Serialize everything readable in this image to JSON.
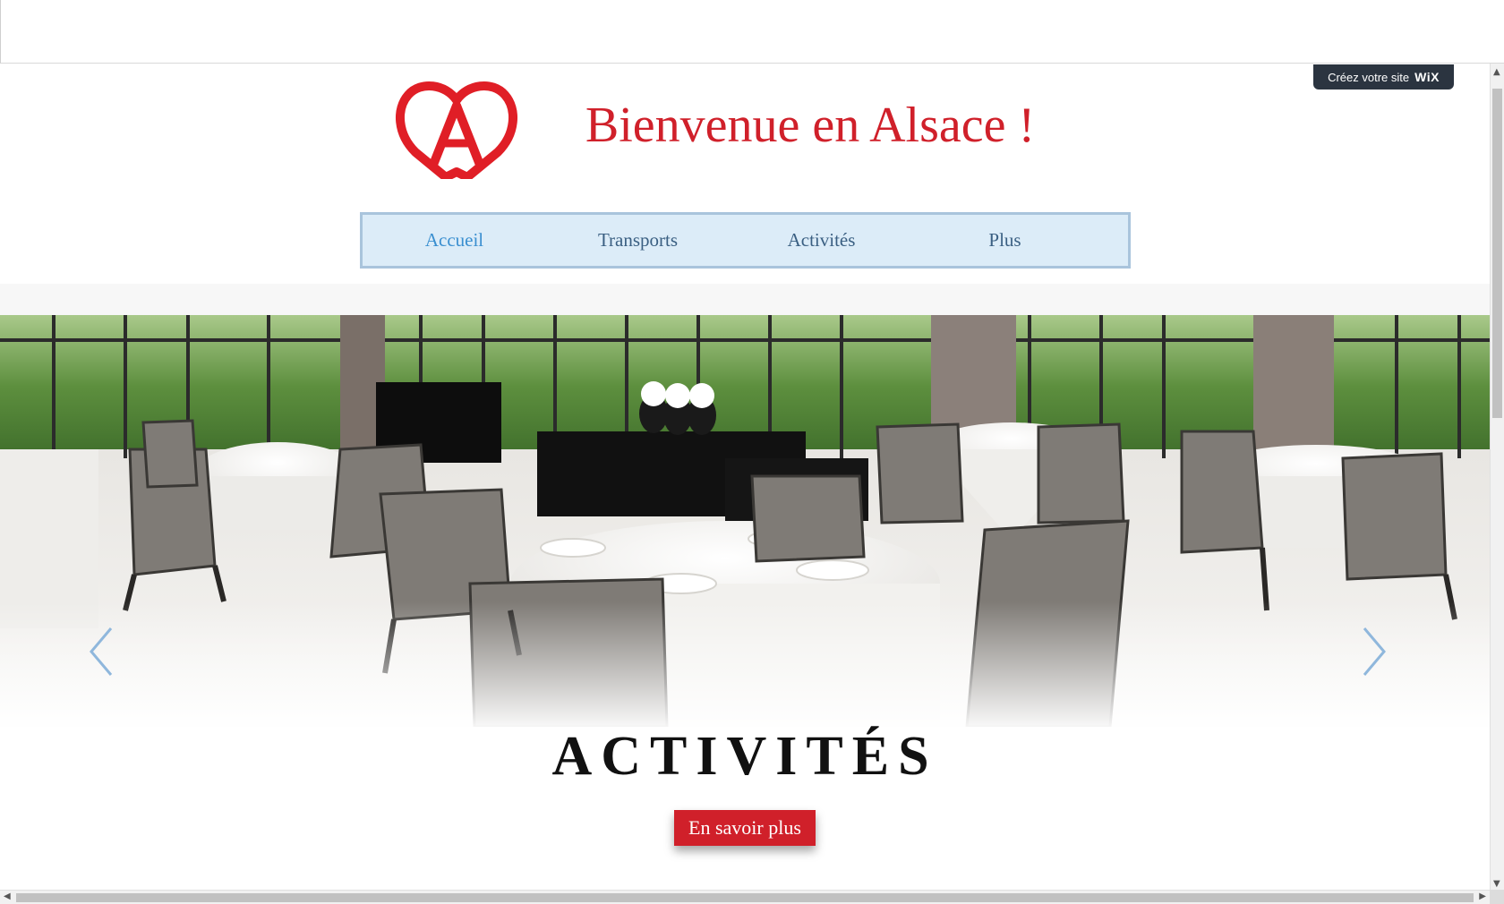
{
  "wix_badge": {
    "text": "Créez votre site",
    "brand": "WiX"
  },
  "site": {
    "title": "Bienvenue en Alsace !",
    "logo_icon": "alsace-heart-a-logo",
    "accent_color": "#d0202a"
  },
  "nav": {
    "items": [
      {
        "label": "Accueil",
        "active": true
      },
      {
        "label": "Transports",
        "active": false
      },
      {
        "label": "Activités",
        "active": false
      },
      {
        "label": "Plus",
        "active": false
      }
    ]
  },
  "slideshow": {
    "image": "restaurant-dining-room-photo",
    "prev_icon": "chevron-left-icon",
    "next_icon": "chevron-right-icon"
  },
  "section": {
    "title": "ACTIVITÉS",
    "button_label": "En savoir plus"
  },
  "scrollbars": {
    "up": "▲",
    "down": "▼",
    "left": "◀",
    "right": "▶"
  }
}
